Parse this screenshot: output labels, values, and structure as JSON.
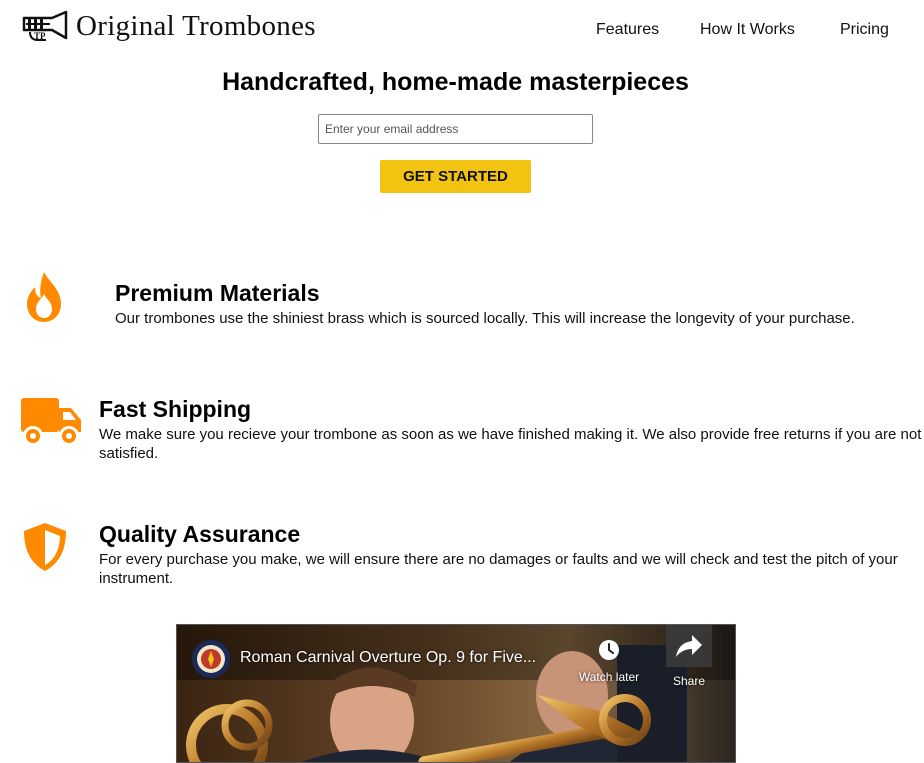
{
  "header": {
    "logo_text": "Original Trombones",
    "nav": [
      "Features",
      "How It Works",
      "Pricing"
    ]
  },
  "hero": {
    "title": "Handcrafted, home-made masterpieces",
    "email_placeholder": "Enter your email address",
    "cta_label": "GET STARTED"
  },
  "features": [
    {
      "icon": "fire-icon",
      "title": "Premium Materials",
      "description": "Our trombones use the shiniest brass which is sourced locally. This will increase the longevity of your purchase."
    },
    {
      "icon": "truck-icon",
      "title": "Fast Shipping",
      "description": "We make sure you recieve your trombone as soon as we have finished making it. We also provide free returns if you are not satisfied."
    },
    {
      "icon": "shield-icon",
      "title": "Quality Assurance",
      "description": "For every purchase you make, we will ensure there are no damages or faults and we will check and test the pitch of your instrument."
    }
  ],
  "video": {
    "title": "Roman Carnival Overture Op. 9 for Five...",
    "watch_later_label": "Watch later",
    "share_label": "Share"
  },
  "colors": {
    "accent_yellow": "#f2c311",
    "icon_orange": "#ff8a00"
  }
}
